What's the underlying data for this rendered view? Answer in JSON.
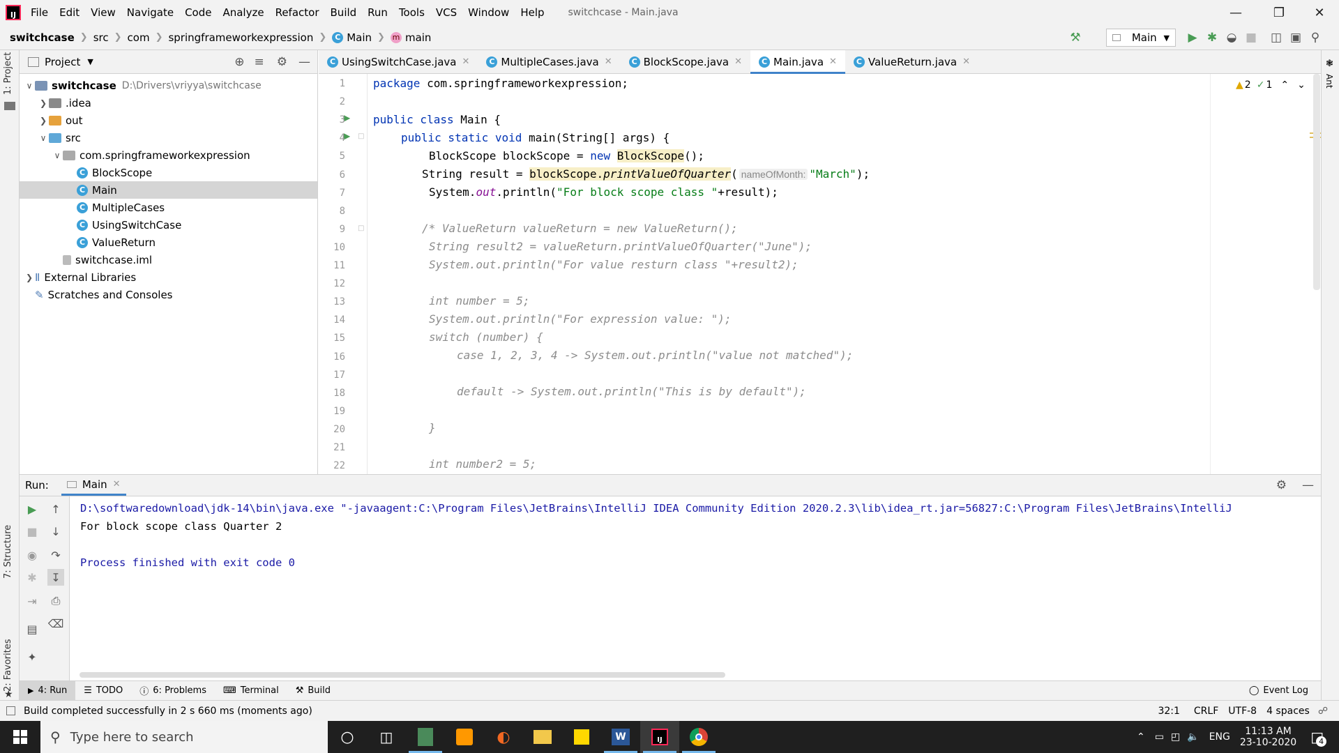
{
  "window": {
    "title": "switchcase - Main.java",
    "logo": "IJ",
    "menus": [
      "File",
      "Edit",
      "View",
      "Navigate",
      "Code",
      "Analyze",
      "Refactor",
      "Build",
      "Run",
      "Tools",
      "VCS",
      "Window",
      "Help"
    ]
  },
  "breadcrumb": [
    "switchcase",
    "src",
    "com",
    "springframeworkexpression",
    "Main",
    "main"
  ],
  "toolbar": {
    "run_config": "Main"
  },
  "left_strip": {
    "project": "1: Project",
    "structure": "7: Structure",
    "favorites": "2: Favorites"
  },
  "right_strip": {
    "ant": "Ant"
  },
  "project_panel": {
    "title": "Project",
    "tree": [
      {
        "label": "switchcase",
        "path": "D:\\Drivers\\vriyya\\switchcase",
        "level": 0,
        "kind": "module",
        "expanded": true
      },
      {
        "label": ".idea",
        "level": 1,
        "kind": "folder-gray",
        "expanded": false
      },
      {
        "label": "out",
        "level": 1,
        "kind": "folder-orange",
        "expanded": false
      },
      {
        "label": "src",
        "level": 1,
        "kind": "folder-blue",
        "expanded": true
      },
      {
        "label": "com.springframeworkexpression",
        "level": 2,
        "kind": "package",
        "expanded": true
      },
      {
        "label": "BlockScope",
        "level": 3,
        "kind": "class"
      },
      {
        "label": "Main",
        "level": 3,
        "kind": "class",
        "selected": true
      },
      {
        "label": "MultipleCases",
        "level": 3,
        "kind": "class"
      },
      {
        "label": "UsingSwitchCase",
        "level": 3,
        "kind": "class"
      },
      {
        "label": "ValueReturn",
        "level": 3,
        "kind": "class"
      },
      {
        "label": "switchcase.iml",
        "level": 2,
        "kind": "file"
      },
      {
        "label": "External Libraries",
        "level": 0,
        "kind": "libraries",
        "expanded": false
      },
      {
        "label": "Scratches and Consoles",
        "level": 0,
        "kind": "scratches"
      }
    ]
  },
  "tabs": [
    {
      "label": "UsingSwitchCase.java"
    },
    {
      "label": "MultipleCases.java"
    },
    {
      "label": "BlockScope.java"
    },
    {
      "label": "Main.java",
      "active": true
    },
    {
      "label": "ValueReturn.java"
    }
  ],
  "inspections": {
    "warnings": "2",
    "ok": "1"
  },
  "code": {
    "line_numbers": [
      "1",
      "2",
      "3",
      "4",
      "5",
      "6",
      "7",
      "8",
      "9",
      "10",
      "11",
      "12",
      "13",
      "14",
      "15",
      "16",
      "17",
      "18",
      "19",
      "20",
      "21",
      "22"
    ],
    "l1_kw": "package",
    "l1_rest": " com.springframeworkexpression;",
    "l3_kw": "public class",
    "l3_rest": " Main {",
    "l4_kw": "public static void",
    "l4_rest": " main(String[] args) {",
    "l5_a": "BlockScope blockScope = ",
    "l5_kw": "new",
    "l5_sp": " ",
    "l5_hl": "BlockScope",
    "l5_end": "();",
    "l6_a": "String result = ",
    "l6_hl_a": "blockScope.",
    "l6_hl_b": "printValueOfQuarter",
    "l6_paren": "(",
    "l6_hint": "nameOfMonth:",
    "l6_str": "\"March\"",
    "l6_end": ");",
    "l7_a": "System.",
    "l7_fld": "out",
    "l7_b": ".println(",
    "l7_str": "\"For block scope class \"",
    "l7_end": "+result);",
    "c9": "/* ValueReturn valueReturn = new ValueReturn();",
    "c10": "String result2 = valueReturn.printValueOfQuarter(\"June\");",
    "c11": "System.out.println(\"For value resturn class \"+result2);",
    "c13": "int number = 5;",
    "c14": "System.out.println(\"For expression value: \");",
    "c15": "switch (number) {",
    "c16": "case 1, 2, 3, 4 -> System.out.println(\"value not matched\");",
    "c18": "default -> System.out.println(\"This is by default\");",
    "c20": "}",
    "c22": "int number2 = 5;"
  },
  "run_panel": {
    "label": "Run:",
    "tab": "Main",
    "output": [
      "D:\\softwaredownload\\jdk-14\\bin\\java.exe \"-javaagent:C:\\Program Files\\JetBrains\\IntelliJ IDEA Community Edition 2020.2.3\\lib\\idea_rt.jar=56827:C:\\Program Files\\JetBrains\\IntelliJ",
      "For block scope class Quarter 2",
      "",
      "Process finished with exit code 0"
    ]
  },
  "bottom_tabs": {
    "run": "4: Run",
    "todo": "TODO",
    "problems": "6: Problems",
    "terminal": "Terminal",
    "build": "Build",
    "event_log": "Event Log"
  },
  "status": {
    "message": "Build completed successfully in 2 s 660 ms (moments ago)",
    "position": "32:1",
    "line_sep": "CRLF",
    "encoding": "UTF-8",
    "indent": "4 spaces"
  },
  "taskbar": {
    "search_placeholder": "Type here to search",
    "lang": "ENG",
    "time": "11:13 AM",
    "date": "23-10-2020",
    "notifications": "4"
  },
  "colors": {
    "accent": "#4083c9",
    "keyword": "#0033b3",
    "string": "#067d17",
    "comment": "#8c8c8c"
  }
}
